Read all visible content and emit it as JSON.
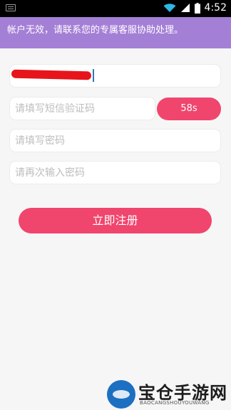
{
  "status_bar": {
    "time": "4:52",
    "icons": [
      "keyboard-icon",
      "wifi-icon",
      "signal-icon",
      "battery-icon"
    ]
  },
  "banner": {
    "text": "帐户无效，请联系您的专属客服协助处理。",
    "color": "#a47fd6"
  },
  "form": {
    "phone_value": "",
    "code_placeholder": "请填写短信验证码",
    "countdown_label": "58s",
    "password_placeholder": "请填写密码",
    "confirm_placeholder": "请再次输入密码",
    "submit_label": "立即注册",
    "accent_color": "#f0456d"
  },
  "watermark": {
    "title": "宝仓手游网",
    "subtitle": "BAOCANGSHOUYOUWANG"
  }
}
